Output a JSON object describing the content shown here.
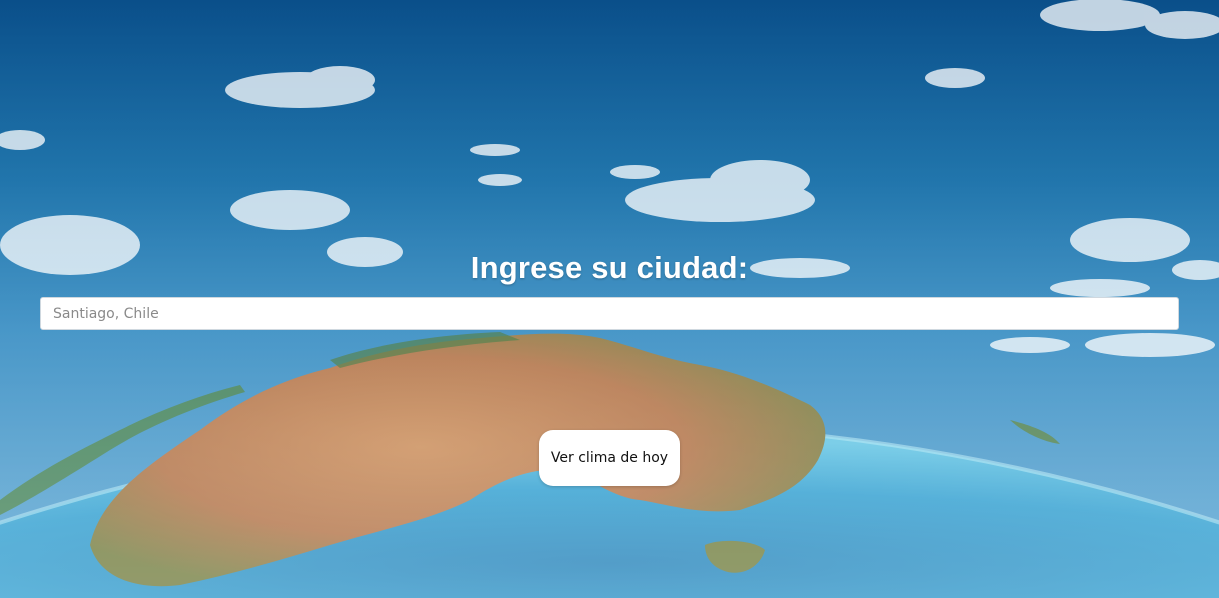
{
  "header": {
    "title": "Ingrese su ciudad:"
  },
  "search": {
    "placeholder": "Santiago, Chile",
    "value": ""
  },
  "actions": {
    "submit_label": "Ver clima de hoy"
  },
  "colors": {
    "sky_top": "#0a4f8a",
    "ocean": "#2ea7d6",
    "land": "#b87a4b",
    "button_bg": "#ffffff"
  }
}
